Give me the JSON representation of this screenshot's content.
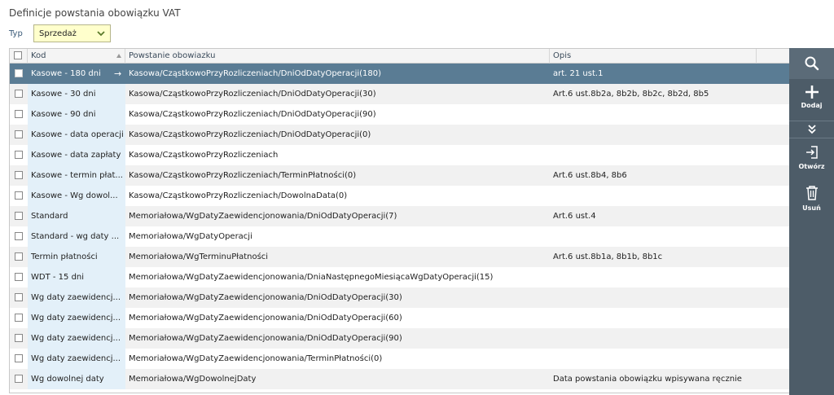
{
  "header": {
    "title": "Definicje powstania obowiązku VAT"
  },
  "filter": {
    "label": "Typ",
    "value": "Sprzedaż"
  },
  "grid": {
    "columns": {
      "kod": "Kod",
      "powstanie": "Powstanie obowiazku",
      "opis": "Opis"
    },
    "rows": [
      {
        "kod": "Kasowe - 180 dni",
        "powstanie": "Kasowa/CząstkowoPrzyRozliczeniach/DniOdDatyOperacji(180)",
        "opis": "art. 21 ust.1"
      },
      {
        "kod": "Kasowe - 30 dni",
        "powstanie": "Kasowa/CząstkowoPrzyRozliczeniach/DniOdDatyOperacji(30)",
        "opis": "Art.6 ust.8b2a, 8b2b, 8b2c, 8b2d, 8b5"
      },
      {
        "kod": "Kasowe - 90 dni",
        "powstanie": "Kasowa/CząstkowoPrzyRozliczeniach/DniOdDatyOperacji(90)",
        "opis": ""
      },
      {
        "kod": "Kasowe - data operacji",
        "powstanie": "Kasowa/CząstkowoPrzyRozliczeniach/DniOdDatyOperacji(0)",
        "opis": ""
      },
      {
        "kod": "Kasowe - data zapłaty",
        "powstanie": "Kasowa/CząstkowoPrzyRozliczeniach",
        "opis": ""
      },
      {
        "kod": "Kasowe - termin płat...",
        "powstanie": "Kasowa/CząstkowoPrzyRozliczeniach/TerminPłatności(0)",
        "opis": "Art.6 ust.8b4, 8b6"
      },
      {
        "kod": "Kasowe - Wg dowol...",
        "powstanie": "Kasowa/CząstkowoPrzyRozliczeniach/DowolnaData(0)",
        "opis": ""
      },
      {
        "kod": "Standard",
        "powstanie": "Memoriałowa/WgDatyZaewidencjonowania/DniOdDatyOperacji(7)",
        "opis": "Art.6 ust.4"
      },
      {
        "kod": "Standard - wg daty ...",
        "powstanie": "Memoriałowa/WgDatyOperacji",
        "opis": ""
      },
      {
        "kod": "Termin płatności",
        "powstanie": "Memoriałowa/WgTerminuPłatności",
        "opis": "Art.6 ust.8b1a, 8b1b, 8b1c"
      },
      {
        "kod": "WDT - 15 dni",
        "powstanie": "Memoriałowa/WgDatyZaewidencjonowania/DniaNastępnegoMiesiącaWgDatyOperacji(15)",
        "opis": ""
      },
      {
        "kod": "Wg daty zaewidencj...",
        "powstanie": "Memoriałowa/WgDatyZaewidencjonowania/DniOdDatyOperacji(30)",
        "opis": ""
      },
      {
        "kod": "Wg daty zaewidencj...",
        "powstanie": "Memoriałowa/WgDatyZaewidencjonowania/DniOdDatyOperacji(60)",
        "opis": ""
      },
      {
        "kod": "Wg daty zaewidencj...",
        "powstanie": "Memoriałowa/WgDatyZaewidencjonowania/DniOdDatyOperacji(90)",
        "opis": ""
      },
      {
        "kod": "Wg daty zaewidencj...",
        "powstanie": "Memoriałowa/WgDatyZaewidencjonowania/TerminPłatności(0)",
        "opis": ""
      },
      {
        "kod": "Wg dowolnej daty",
        "powstanie": "Memoriałowa/WgDowolnejDaty",
        "opis": "Data powstania obowiązku wpisywana ręcznie"
      }
    ],
    "selected_index": 0
  },
  "toolbar": {
    "search_icon": "search-icon",
    "add_label": "Dodaj",
    "expand_icon": "double-chevron-down-icon",
    "open_label": "Otwórz",
    "delete_label": "Usuń"
  },
  "colors": {
    "selected_row": "#5a7c94",
    "toolbar_bg": "#4d5c68",
    "select_bg": "#ffffcc",
    "kod_column_bg": "#e3f0f9"
  }
}
